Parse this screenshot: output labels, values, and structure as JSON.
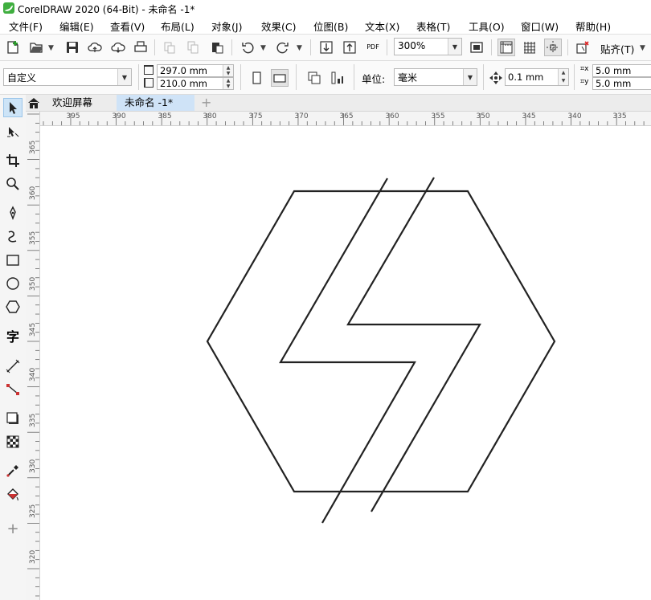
{
  "window": {
    "title": "CorelDRAW 2020 (64-Bit) - 未命名 -1*"
  },
  "menu": [
    "文件(F)",
    "编辑(E)",
    "查看(V)",
    "布局(L)",
    "对象(J)",
    "效果(C)",
    "位图(B)",
    "文本(X)",
    "表格(T)",
    "工具(O)",
    "窗口(W)",
    "帮助(H)"
  ],
  "toolbar": {
    "zoom_value": "300%",
    "pdf_label": "PDF",
    "snap_label": "贴齐(T)"
  },
  "property_bar": {
    "page_preset": "自定义",
    "page_width": "297.0 mm",
    "page_height": "210.0 mm",
    "units_label": "单位:",
    "units_value": "毫米",
    "nudge_value": "0.1 mm",
    "dup_x": "5.0 mm",
    "dup_y": "5.0 mm"
  },
  "tabs": [
    {
      "label": "欢迎屏幕",
      "active": false
    },
    {
      "label": "未命名 -1*",
      "active": true
    }
  ],
  "tabs_add_label": "+",
  "ruler": {
    "horizontal": [
      "395",
      "390",
      "385",
      "380",
      "375",
      "370",
      "365",
      "360",
      "355",
      "350",
      "345",
      "340",
      "335"
    ],
    "vertical": [
      "365",
      "360",
      "355",
      "350",
      "345",
      "340",
      "335",
      "330",
      "325",
      "320"
    ]
  },
  "toolbox": {
    "text_tool_glyph": "字",
    "add_tool_glyph": "+"
  },
  "colors": {
    "accent": "#cfe3f7",
    "canvas": "#ffffff",
    "stroke": "#222222"
  }
}
